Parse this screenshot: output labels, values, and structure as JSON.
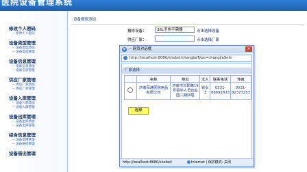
{
  "app": {
    "title": "医院设备管理系统"
  },
  "sidebar": {
    "sections": [
      {
        "title": "修改个人密码",
        "items": [
          "修改个人密码"
        ]
      },
      {
        "title": "设备类型管理",
        "items": [
          "设备类型添加",
          "设备类型管理"
        ]
      },
      {
        "title": "设备信息管理",
        "items": [
          "设备信息添加",
          "设备信息管理"
        ]
      },
      {
        "title": "供应厂家管理",
        "items": [
          "供应厂家添加",
          "供应厂家管理"
        ]
      },
      {
        "title": "设备入库管理",
        "items": [
          "设备入库添加",
          "设备入库管理"
        ]
      },
      {
        "title": "设备出库管理",
        "items": [
          "设备出库添加",
          "设备出库管理"
        ]
      },
      {
        "title": "综合信息管理",
        "items": [
          "设备借用管理",
          "设备维修管理"
        ]
      },
      {
        "title": "设备借出管理",
        "items": []
      }
    ]
  },
  "content": {
    "breadcrumb": "设备报修添加",
    "fields": [
      {
        "label": "报修设备：",
        "value": "36L手热不需器",
        "link": "点击选择设备"
      },
      {
        "label": "供应厂家：",
        "value": "",
        "link": "点击选择厂家"
      }
    ]
  },
  "popup": {
    "title": "-- 网页对话框",
    "close": "×",
    "url": "http://localhost:8080/shebei/changjiaType=changjiaSele",
    "section_title": "厂家选择",
    "columns": [
      "",
      "名称",
      "地址",
      "法人",
      "联系电话",
      "传真"
    ],
    "rows": [
      {
        "name": "济南百通医院用品有限公司",
        "address": "济南市长勤路19号留学人员创业园二期四层",
        "legal": "钱女士",
        "phone": "0531-88692833",
        "fax": "0531-82373253"
      }
    ],
    "select_button": "选择",
    "status_url": "http://localhost:8080/shebei/",
    "zone": "Internet | 保护模式: 关闭"
  }
}
